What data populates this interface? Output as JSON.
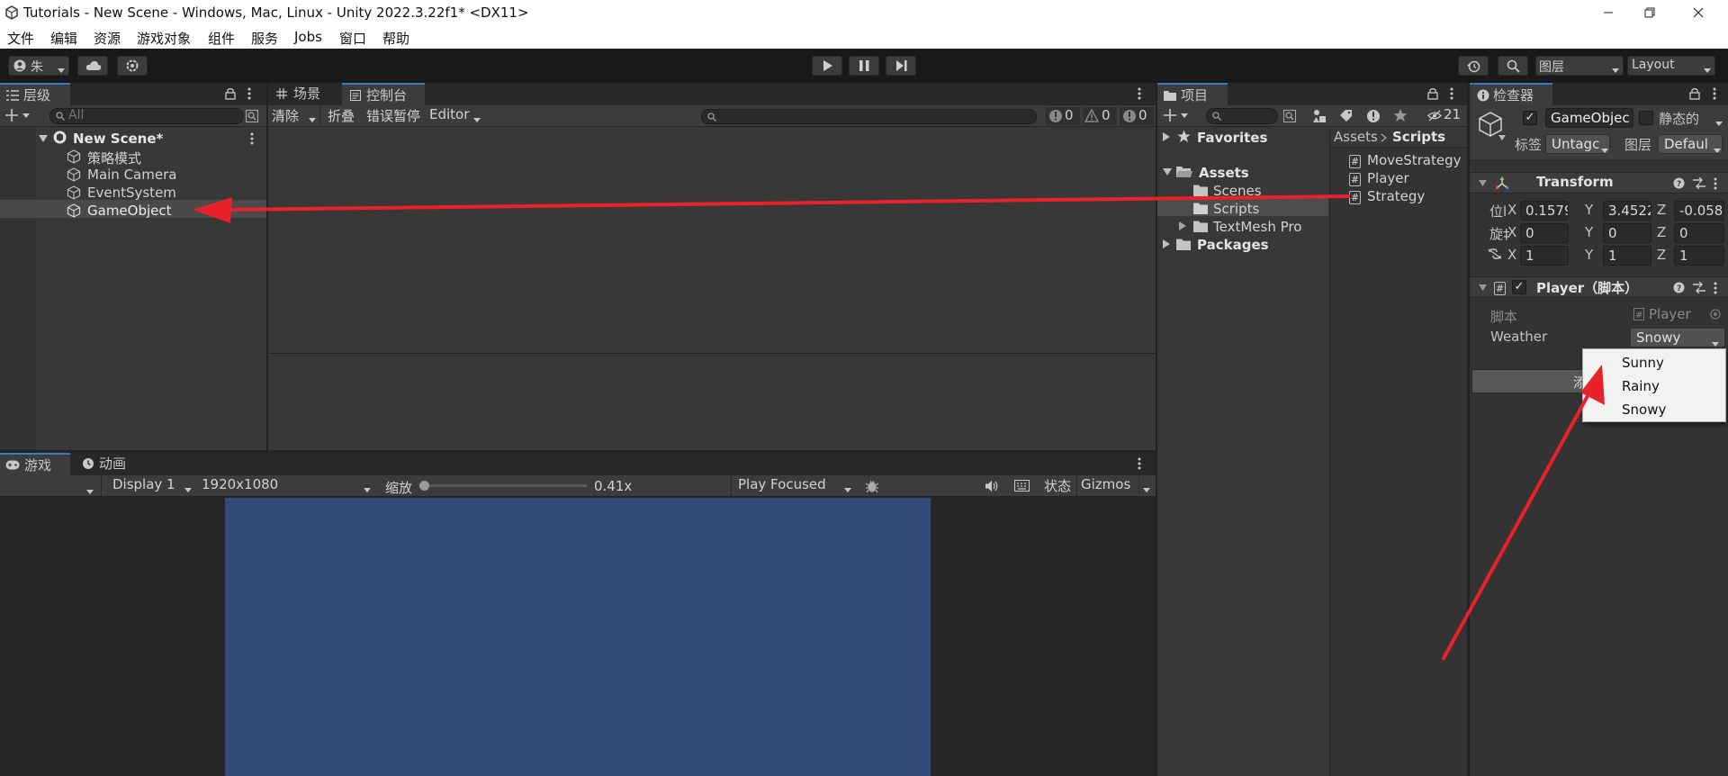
{
  "window": {
    "title": "Tutorials - New Scene - Windows, Mac, Linux - Unity 2022.3.22f1* <DX11>"
  },
  "menu": [
    "文件",
    "编辑",
    "资源",
    "游戏对象",
    "组件",
    "服务",
    "Jobs",
    "窗口",
    "帮助"
  ],
  "toolbar": {
    "account": "朱",
    "layers": "图层",
    "layout": "Layout"
  },
  "hierarchy": {
    "tab": "层级",
    "search_placeholder": "All",
    "scene": "New Scene*",
    "items": [
      "策略模式",
      "Main Camera",
      "EventSystem",
      "GameObject"
    ]
  },
  "scene_tab": "场景",
  "console": {
    "tab": "控制台",
    "clear": "清除",
    "collapse": "折叠",
    "error_pause": "错误暂停",
    "editor": "Editor",
    "count_info": "0",
    "count_warn": "0",
    "count_error": "0"
  },
  "game": {
    "tab": "游戏",
    "anim_tab": "动画",
    "display": "Display 1",
    "resolution": "1920x1080",
    "scale_label": "缩放",
    "scale_value": "0.41x",
    "play_mode": "Play Focused",
    "stats": "状态",
    "gizmos": "Gizmos"
  },
  "project": {
    "tab": "项目",
    "hidden_count": "21",
    "favorites": "Favorites",
    "assets": "Assets",
    "folders": [
      "Scenes",
      "Scripts",
      "TextMesh Pro"
    ],
    "packages": "Packages",
    "breadcrumb_root": "Assets",
    "breadcrumb_current": "Scripts",
    "files": [
      "MoveStrategy",
      "Player",
      "Strategy"
    ]
  },
  "inspector": {
    "tab": "检查器",
    "object_name": "GameObjec",
    "static_label": "静态的",
    "tag_label": "标签",
    "tag_value": "Untagc",
    "layer_label": "图层",
    "layer_value": "Defaul",
    "transform": {
      "title": "Transform",
      "pos_label": "位l",
      "rot_label": "旋‡",
      "pos": [
        "0.1579",
        "3.4522",
        "-0.058"
      ],
      "rot": [
        "0",
        "0",
        "0"
      ],
      "scale": [
        "1",
        "1",
        "1"
      ]
    },
    "player": {
      "title": "Player（脚本）",
      "script_label": "脚本",
      "script_value": "Player",
      "weather_label": "Weather",
      "weather_value": "Snowy",
      "add_partial": "添"
    },
    "dropdown_options": [
      "Sunny",
      "Rainy",
      "Snowy"
    ]
  }
}
